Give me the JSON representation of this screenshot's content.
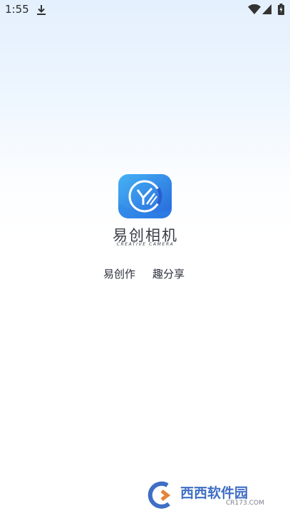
{
  "status_bar": {
    "time": "1:55",
    "icons": [
      "download-icon",
      "wifi-icon",
      "cell-signal-icon",
      "battery-icon"
    ]
  },
  "splash": {
    "logo_icon": "camera-lens-logo-icon",
    "app_name": "易创相机",
    "app_subtitle": "CREATIVE CAMERA",
    "slogan_left": "易创作",
    "slogan_right": "趣分享"
  },
  "watermark": {
    "brand": "西西软件园",
    "url": "CR173.COM"
  },
  "colors": {
    "logo_gradient_start": "#3ea6f0",
    "logo_gradient_end": "#2b73e0",
    "background_top": "#e4f0fd",
    "text": "#2b2f3a"
  }
}
